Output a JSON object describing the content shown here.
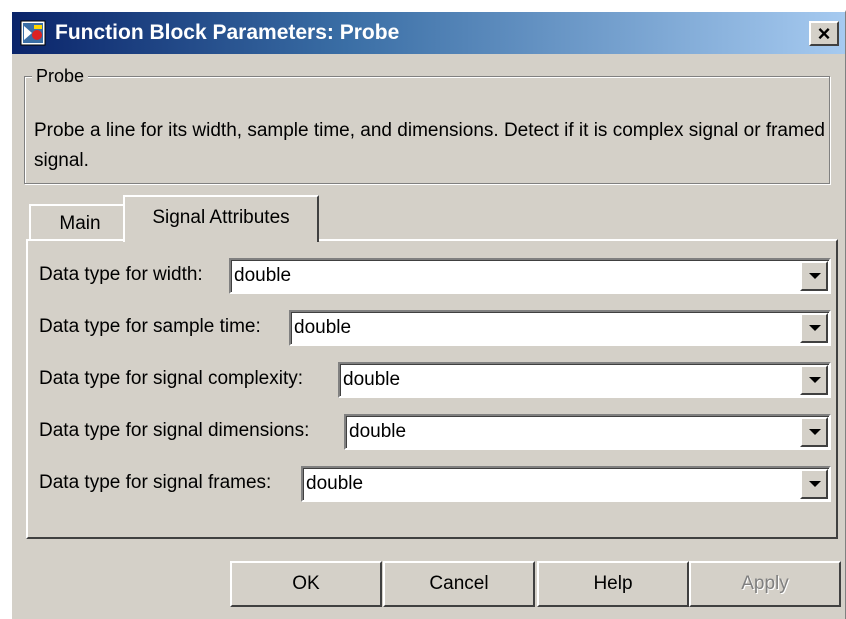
{
  "window": {
    "title": "Function Block Parameters: Probe",
    "close_label": "×"
  },
  "group": {
    "legend": "Probe",
    "description": "Probe a line for its width, sample time, and dimensions. Detect if it is complex signal or framed signal."
  },
  "tabs": [
    {
      "label": "Main",
      "active": false
    },
    {
      "label": "Signal Attributes",
      "active": true
    }
  ],
  "fields": [
    {
      "label": "Data type for width:",
      "value": "double"
    },
    {
      "label": "Data type for sample time:",
      "value": "double"
    },
    {
      "label": "Data type for signal complexity:",
      "value": "double"
    },
    {
      "label": "Data type for signal dimensions:",
      "value": "double"
    },
    {
      "label": "Data type for signal frames:",
      "value": "double"
    }
  ],
  "buttons": {
    "ok": "OK",
    "cancel": "Cancel",
    "help": "Help",
    "apply": "Apply"
  },
  "icons": {
    "title_icon": "simulink-block-icon",
    "dropdown_icon": "chevron-down-icon"
  },
  "colors": {
    "title_bar_start": "#0a246a",
    "title_bar_end": "#a6caf0",
    "face": "#d4d0c8"
  }
}
